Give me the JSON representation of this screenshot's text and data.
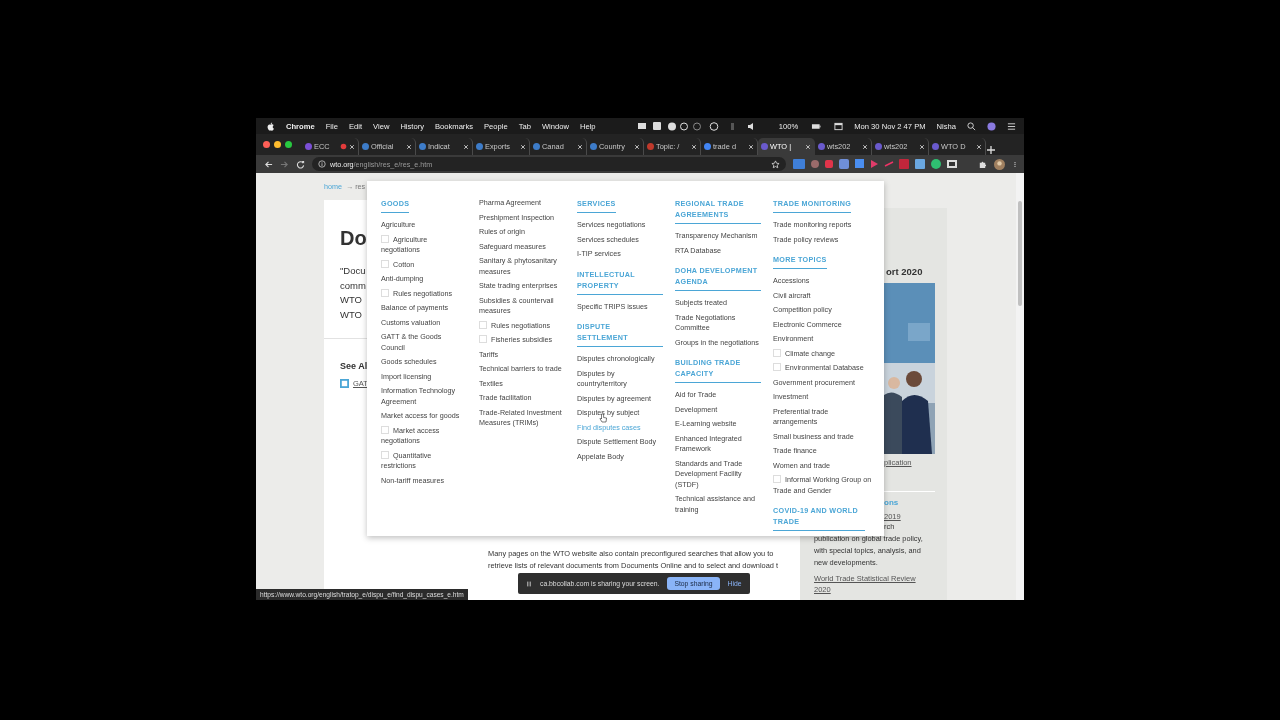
{
  "menubar": {
    "app": "Chrome",
    "items": [
      "File",
      "Edit",
      "View",
      "History",
      "Bookmarks",
      "People",
      "Tab",
      "Window",
      "Help"
    ],
    "battery": "100%",
    "clock": "Mon 30 Nov  2 47 PM",
    "user": "Nisha"
  },
  "tabs": [
    {
      "title": "ECC",
      "selected": false,
      "recording": true,
      "color": "#7b4fd6"
    },
    {
      "title": "Official",
      "selected": false,
      "recording": false,
      "color": "#3d7cc9"
    },
    {
      "title": "Indicat",
      "selected": false,
      "recording": false,
      "color": "#3d7cc9"
    },
    {
      "title": "Exports",
      "selected": false,
      "recording": false,
      "color": "#3d7cc9"
    },
    {
      "title": "Canad",
      "selected": false,
      "recording": false,
      "color": "#3d7cc9"
    },
    {
      "title": "Country",
      "selected": false,
      "recording": false,
      "color": "#3d7cc9"
    },
    {
      "title": "Topic: /",
      "selected": false,
      "recording": false,
      "color": "#c0392b"
    },
    {
      "title": "trade d",
      "selected": false,
      "recording": false,
      "color": "#4285f4"
    },
    {
      "title": "WTO |",
      "selected": true,
      "recording": false,
      "color": "#6a5acd"
    },
    {
      "title": "wts202",
      "selected": false,
      "recording": false,
      "color": "#6a5acd"
    },
    {
      "title": "wts202",
      "selected": false,
      "recording": false,
      "color": "#6a5acd"
    },
    {
      "title": "WTO D",
      "selected": false,
      "recording": false,
      "color": "#6a5acd"
    }
  ],
  "address": {
    "host": "wto.org",
    "path": "/english/res_e/res_e.htm"
  },
  "page": {
    "breadcrumb": {
      "home": "home",
      "rest": "→ res"
    },
    "title": "Do",
    "intro_lines": [
      "\"Docu",
      "comm",
      "WTO",
      "WTO"
    ],
    "see_also": "See Al",
    "see_also_link": "GAT",
    "bottom_text": "Many pages on the WTO website also contain preconfigured searches that allow you to retrieve lists of relevant documents from Documents Online and to select and download t",
    "sidebar": {
      "report_title": "ort 2020",
      "report_link": "plication",
      "heading": "ons",
      "link_2019": "2019",
      "desc_first": "rch",
      "desc": "publication on global trade policy, with special topics, analysis, and new developments.",
      "link_review": "World Trade Statistical Review",
      "link_review_2": "2020"
    }
  },
  "menu": {
    "columns": [
      {
        "sections": [
          {
            "heading": "GOODS",
            "items": [
              {
                "label": "Agriculture",
                "kind": "link"
              },
              {
                "label": "Agriculture negotiations",
                "kind": "sub"
              },
              {
                "label": "Cotton",
                "kind": "sub"
              },
              {
                "label": "Anti-dumping",
                "kind": "link"
              },
              {
                "label": "Rules negotiations",
                "kind": "sub"
              },
              {
                "label": "Balance of payments",
                "kind": "link"
              },
              {
                "label": "Customs valuation",
                "kind": "link"
              },
              {
                "label": "GATT & the Goods Council",
                "kind": "link"
              },
              {
                "label": "Goods schedules",
                "kind": "link"
              },
              {
                "label": "Import licensing",
                "kind": "link"
              },
              {
                "label": "Information Technology Agreement",
                "kind": "link"
              },
              {
                "label": "Market access for goods",
                "kind": "link"
              },
              {
                "label": "Market access negotiations",
                "kind": "sub"
              },
              {
                "label": "Quantitative restrictions",
                "kind": "sub"
              },
              {
                "label": "Non-tariff measures",
                "kind": "link"
              }
            ]
          }
        ]
      },
      {
        "sections": [
          {
            "items": [
              {
                "label": "Pharma Agreement",
                "kind": "link"
              },
              {
                "label": "Preshipment Inspection",
                "kind": "link"
              },
              {
                "label": "Rules of origin",
                "kind": "link"
              },
              {
                "label": "Safeguard measures",
                "kind": "link"
              },
              {
                "label": "Sanitary & phytosanitary measures",
                "kind": "link"
              },
              {
                "label": "State trading enterprises",
                "kind": "link"
              },
              {
                "label": "Subsidies & countervail measures",
                "kind": "link"
              },
              {
                "label": "Rules negotiations",
                "kind": "sub"
              },
              {
                "label": "Fisheries subsidies",
                "kind": "sub"
              },
              {
                "label": "Tariffs",
                "kind": "link"
              },
              {
                "label": "Technical barriers to trade",
                "kind": "link"
              },
              {
                "label": "Textiles",
                "kind": "link"
              },
              {
                "label": "Trade facilitation",
                "kind": "link"
              },
              {
                "label": "Trade-Related Investment Measures (TRIMs)",
                "kind": "link"
              }
            ]
          }
        ]
      },
      {
        "sections": [
          {
            "heading": "SERVICES",
            "items": [
              {
                "label": "Services negotiations",
                "kind": "link"
              },
              {
                "label": "Services schedules",
                "kind": "link"
              },
              {
                "label": "I-TIP services",
                "kind": "link"
              }
            ]
          },
          {
            "heading": "INTELLECTUAL PROPERTY",
            "items": [
              {
                "label": "Specific TRIPS issues",
                "kind": "link"
              }
            ]
          },
          {
            "heading": "DISPUTE SETTLEMENT",
            "items": [
              {
                "label": "Disputes chronologically",
                "kind": "link",
                "highlighted": false
              },
              {
                "label": "Disputes by country/territory",
                "kind": "link",
                "highlighted": false
              },
              {
                "label": "Disputes by agreement",
                "kind": "link",
                "highlighted": false
              },
              {
                "label": "Disputes by subject",
                "kind": "link",
                "highlighted": false
              },
              {
                "label": "Find disputes cases",
                "kind": "link",
                "highlighted": true
              },
              {
                "label": "Dispute Settlement Body",
                "kind": "link",
                "highlighted": false
              },
              {
                "label": "Appelate Body",
                "kind": "link",
                "highlighted": false
              }
            ]
          }
        ]
      },
      {
        "sections": [
          {
            "heading": "REGIONAL TRADE AGREEMENTS",
            "items": [
              {
                "label": "Transparency Mechanism",
                "kind": "link"
              },
              {
                "label": "RTA Database",
                "kind": "link"
              }
            ]
          },
          {
            "heading": "DOHA DEVELOPMENT AGENDA",
            "items": [
              {
                "label": "Subjects treated",
                "kind": "link"
              },
              {
                "label": "Trade Negotiations Committee",
                "kind": "link"
              },
              {
                "label": "Groups in the negotiations",
                "kind": "link"
              }
            ]
          },
          {
            "heading": "BUILDING TRADE CAPACITY",
            "items": [
              {
                "label": "Aid for Trade",
                "kind": "link"
              },
              {
                "label": "Development",
                "kind": "link"
              },
              {
                "label": "E-Learning website",
                "kind": "link"
              },
              {
                "label": "Enhanced Integrated Framework",
                "kind": "link"
              },
              {
                "label": "Standards and Trade Development Facility (STDF)",
                "kind": "link"
              },
              {
                "label": "Technical assistance and training",
                "kind": "link"
              }
            ]
          }
        ]
      },
      {
        "sections": [
          {
            "heading": "TRADE MONITORING",
            "items": [
              {
                "label": "Trade monitoring reports",
                "kind": "link"
              },
              {
                "label": "Trade policy reviews",
                "kind": "link"
              }
            ]
          },
          {
            "heading": "MORE TOPICS",
            "items": [
              {
                "label": "Accessions",
                "kind": "link"
              },
              {
                "label": "Civil aircraft",
                "kind": "link"
              },
              {
                "label": "Competition policy",
                "kind": "link"
              },
              {
                "label": "Electronic Commerce",
                "kind": "link"
              },
              {
                "label": "Environment",
                "kind": "link"
              },
              {
                "label": "Climate change",
                "kind": "sub"
              },
              {
                "label": "Environmental Database",
                "kind": "sub"
              },
              {
                "label": "Government procurement",
                "kind": "link"
              },
              {
                "label": "Investment",
                "kind": "link"
              },
              {
                "label": "Preferential trade arrangements",
                "kind": "link"
              },
              {
                "label": "Small business and trade",
                "kind": "link"
              },
              {
                "label": "Trade finance",
                "kind": "link"
              },
              {
                "label": "Women and trade",
                "kind": "link"
              },
              {
                "label": "Informal Working Group on Trade and Gender",
                "kind": "sub"
              }
            ]
          },
          {
            "heading": "COVID-19 AND WORLD TRADE"
          }
        ]
      }
    ]
  },
  "status_url": "https://www.wto.org/english/tratop_e/dispu_e/find_dispu_cases_e.htm",
  "share_bar": {
    "message": "ca.bbcollab.com is sharing your screen.",
    "stop": "Stop sharing",
    "hide": "Hide"
  }
}
